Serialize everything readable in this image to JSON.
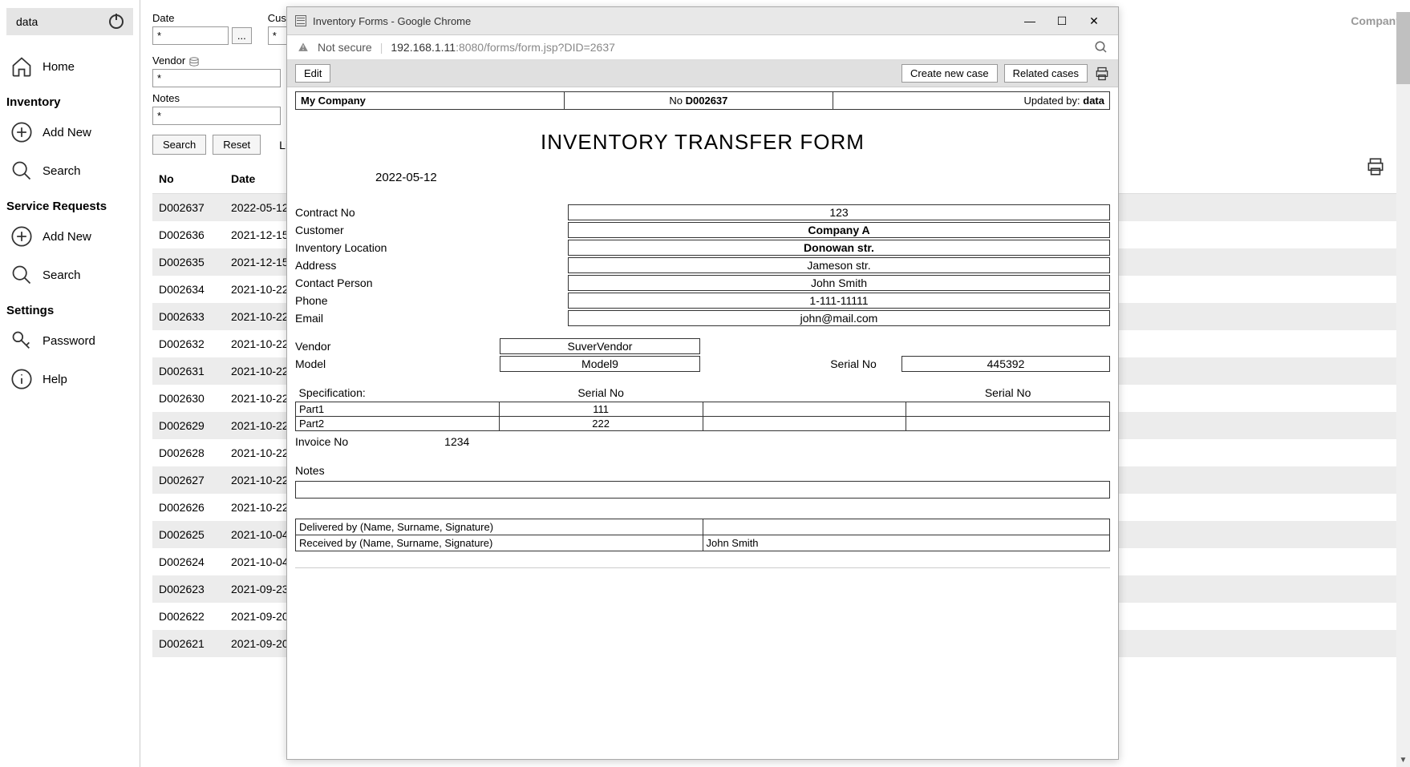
{
  "sidebar": {
    "user": "data",
    "items": {
      "home": "Home",
      "inventory_title": "Inventory",
      "add_new": "Add New",
      "search": "Search",
      "service_title": "Service Requests",
      "settings_title": "Settings",
      "password": "Password",
      "help": "Help"
    }
  },
  "filters": {
    "date_label": "Date",
    "date_value": "*",
    "customer_label": "Customer",
    "customer_value": "*",
    "vendor_label": "Vendor",
    "vendor_value": "*",
    "notes_label": "Notes",
    "notes_value": "*",
    "date_picker_btn": "...",
    "search_btn": "Search",
    "reset_btn": "Reset",
    "limit_label": "Limit to"
  },
  "table": {
    "headers": {
      "no": "No",
      "date": "Date"
    },
    "rows": [
      {
        "no": "D002637",
        "date": "2022-05-12"
      },
      {
        "no": "D002636",
        "date": "2021-12-15"
      },
      {
        "no": "D002635",
        "date": "2021-12-15"
      },
      {
        "no": "D002634",
        "date": "2021-10-22"
      },
      {
        "no": "D002633",
        "date": "2021-10-22"
      },
      {
        "no": "D002632",
        "date": "2021-10-22"
      },
      {
        "no": "D002631",
        "date": "2021-10-22"
      },
      {
        "no": "D002630",
        "date": "2021-10-22"
      },
      {
        "no": "D002629",
        "date": "2021-10-22"
      },
      {
        "no": "D002628",
        "date": "2021-10-22"
      },
      {
        "no": "D002627",
        "date": "2021-10-22"
      },
      {
        "no": "D002626",
        "date": "2021-10-22"
      },
      {
        "no": "D002625",
        "date": "2021-10-04"
      },
      {
        "no": "D002624",
        "date": "2021-10-04"
      },
      {
        "no": "D002623",
        "date": "2021-09-23"
      },
      {
        "no": "D002622",
        "date": "2021-09-20"
      },
      {
        "no": "D002621",
        "date": "2021-09-20"
      }
    ]
  },
  "right": {
    "company": "Company"
  },
  "popup": {
    "window_title": "Inventory Forms - Google Chrome",
    "security": "Not secure",
    "url_host": "192.168.1.11",
    "url_port": ":8080",
    "url_path": "/forms/form.jsp?DID=2637",
    "toolbar": {
      "edit": "Edit",
      "create_case": "Create new case",
      "related_cases": "Related cases"
    },
    "header": {
      "company": "My Company",
      "no_prefix": "No ",
      "no_value": "D002637",
      "updated_prefix": "Updated by: ",
      "updated_by": "data"
    },
    "title": "INVENTORY TRANSFER FORM",
    "date": "2022-05-12",
    "fields": {
      "contract_no_label": "Contract No",
      "contract_no": "123",
      "customer_label": "Customer",
      "customer": "Company A",
      "location_label": "Inventory Location",
      "location": "Donowan str.",
      "address_label": "Address",
      "address": "Jameson str.",
      "contact_label": "Contact Person",
      "contact": "John Smith",
      "phone_label": "Phone",
      "phone": "1-111-11111",
      "email_label": "Email",
      "email": "john@mail.com",
      "vendor_label": "Vendor",
      "vendor": "SuverVendor",
      "model_label": "Model",
      "model": "Model9",
      "serial_label": "Serial No",
      "serial": "445392"
    },
    "spec": {
      "spec_label": "Specification:",
      "serial1_label": "Serial No",
      "serial2_label": "Serial No",
      "rows": [
        {
          "part": "Part1",
          "s1": "111",
          "p2": "",
          "s2": ""
        },
        {
          "part": "Part2",
          "s1": "222",
          "p2": "",
          "s2": ""
        }
      ]
    },
    "invoice": {
      "label": "Invoice No",
      "value": "1234"
    },
    "notes_label": "Notes",
    "sig": {
      "delivered_label": "Delivered by (Name, Surname, Signature)",
      "delivered_value": "",
      "received_label": "Received by (Name, Surname, Signature)",
      "received_value": "John Smith"
    }
  }
}
